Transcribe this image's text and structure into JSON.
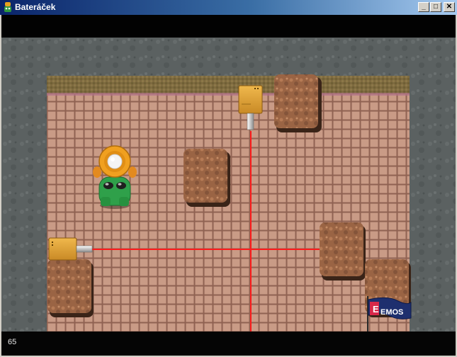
{
  "window": {
    "title": "Bateráček",
    "buttons": {
      "minimize": "_",
      "maximize": "□",
      "close": "✕"
    },
    "icon": "robot-app-icon"
  },
  "game": {
    "counter": "65",
    "colors": {
      "wall": "#5a6060",
      "floor_tile": "#c89a85",
      "grout": "#8e6152",
      "laser": "#ff1c1c",
      "emitter": "#e3a53b",
      "crate": "#9a6343"
    },
    "flag_text": "EMOS",
    "sprites": [
      "robot-player",
      "laser-emitter-top",
      "laser-emitter-left",
      "stone-block",
      "emos-flag"
    ]
  }
}
